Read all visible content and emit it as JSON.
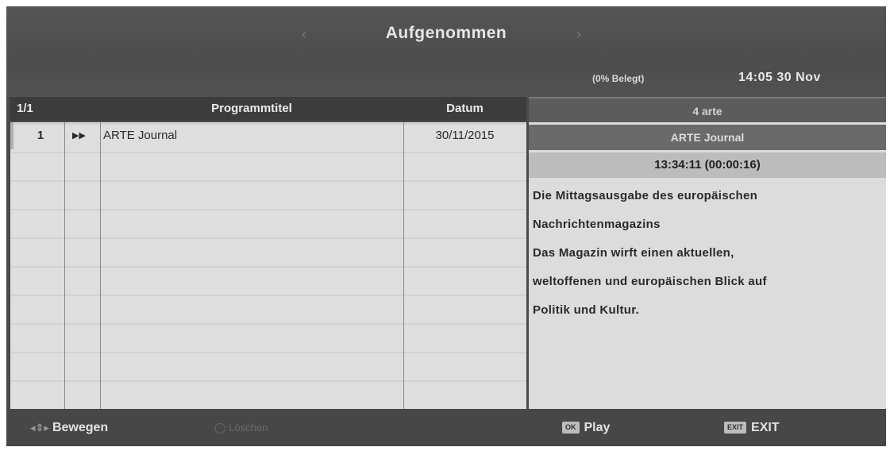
{
  "header": {
    "title": "Aufgenommen",
    "arrow_left": "‹",
    "arrow_right": "›",
    "usage": "(0% Belegt)",
    "clock": "14:05 30 Nov"
  },
  "list": {
    "page": "1/1",
    "columns": {
      "title": "Programmtitel",
      "date": "Datum"
    },
    "rows": [
      {
        "num": "1",
        "icon": "▶▶",
        "title": "ARTE Journal",
        "date": "30/11/2015"
      }
    ]
  },
  "info": {
    "channel": "4 arte",
    "program": "ARTE Journal",
    "time": "13:34:11 (00:00:16)",
    "description_lines": [
      "Die Mittagsausgabe des europäischen",
      "Nachrichtenmagazins",
      "Das Magazin wirft einen aktuellen,",
      "weltoffenen und europäischen Blick auf",
      "Politik und Kultur."
    ]
  },
  "footer": {
    "move_icon": "◂⇕▸",
    "move_label": "Bewegen",
    "delete_icon": "◯",
    "delete_label": "Löschen",
    "play_key": "OK",
    "play_label": "Play",
    "exit_key": "EXIT",
    "exit_label": "EXIT"
  }
}
